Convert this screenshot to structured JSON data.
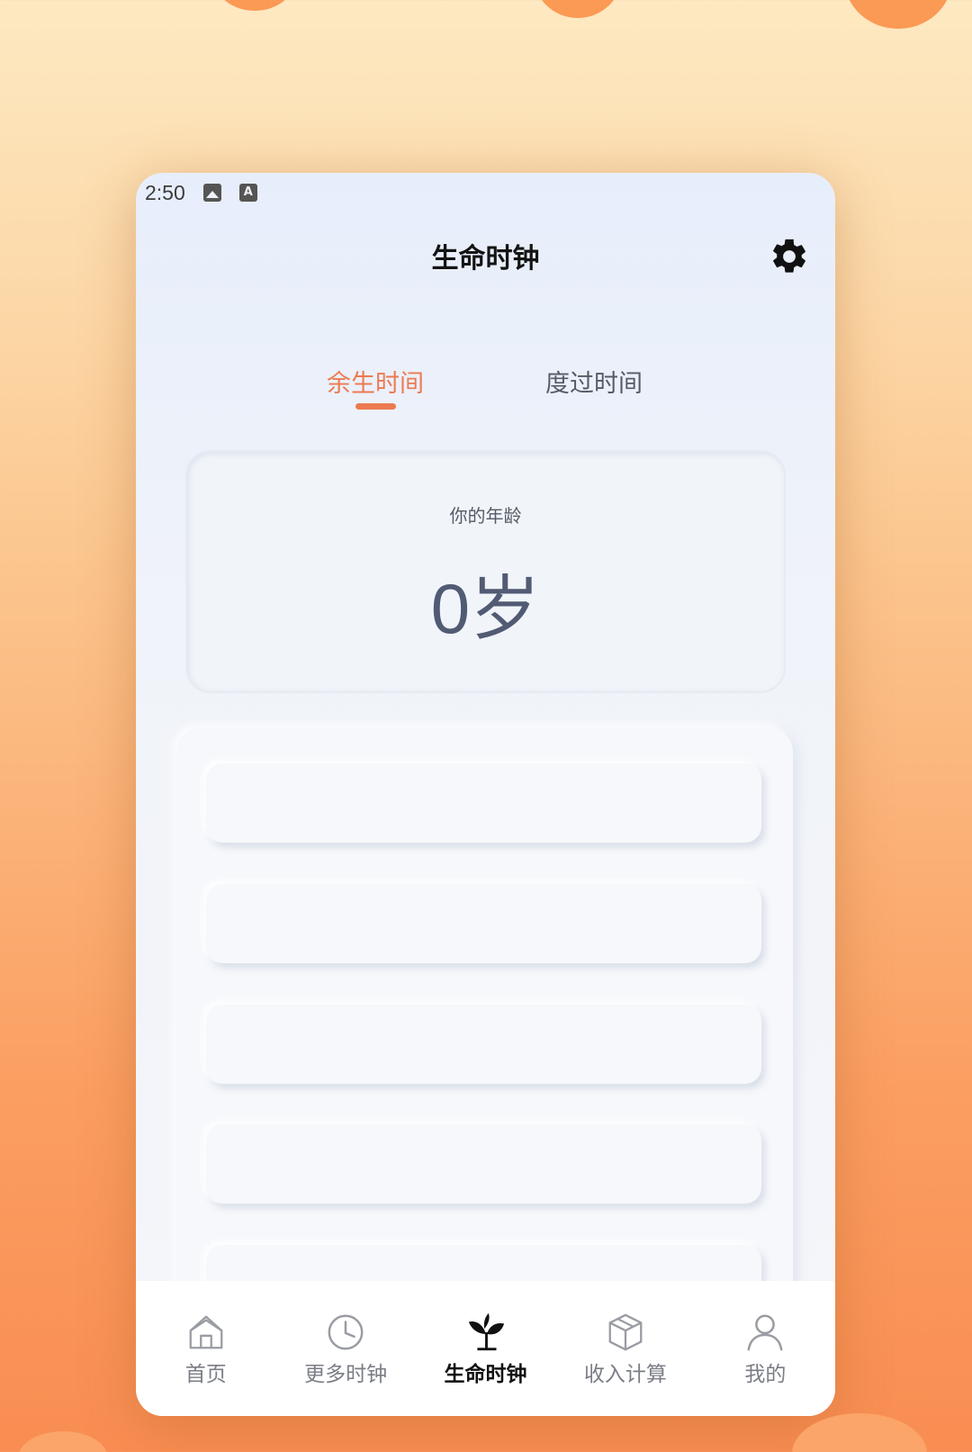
{
  "status_bar": {
    "time": "2:50",
    "icons": [
      "image-icon",
      "font-icon"
    ]
  },
  "header": {
    "title": "生命时钟",
    "settings_icon": "gear-icon"
  },
  "tabs": [
    {
      "label": "余生时间",
      "active": true
    },
    {
      "label": "度过时间",
      "active": false
    }
  ],
  "age_card": {
    "label": "你的年龄",
    "value": "0岁"
  },
  "list": {
    "items": [
      "",
      "",
      "",
      "",
      ""
    ]
  },
  "bottom_nav": {
    "items": [
      {
        "label": "首页",
        "icon": "home-icon",
        "active": false
      },
      {
        "label": "更多时钟",
        "icon": "clock-icon",
        "active": false
      },
      {
        "label": "生命时钟",
        "icon": "sprout-icon",
        "active": true
      },
      {
        "label": "收入计算",
        "icon": "box-icon",
        "active": false
      },
      {
        "label": "我的",
        "icon": "user-icon",
        "active": false
      }
    ]
  },
  "colors": {
    "accent": "#ec7a50",
    "background_top": "#fde9c2",
    "background_bottom": "#f98d52",
    "text_dark": "#525b74"
  }
}
